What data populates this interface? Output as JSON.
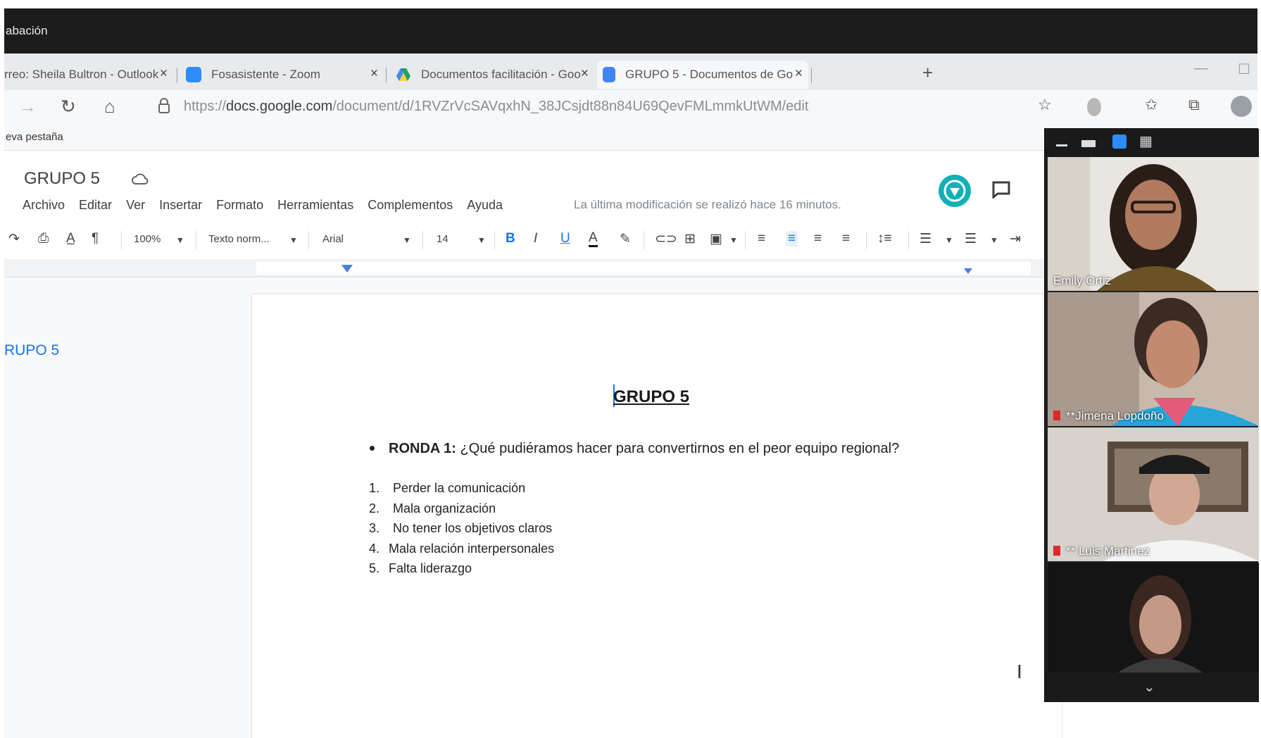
{
  "recording_bar": {
    "label": "abación"
  },
  "tabs": [
    {
      "title": "rreo: Sheila Bultron - Outlook",
      "icon": "outlook-icon"
    },
    {
      "title": "Fosasistente - Zoom",
      "icon": "zoom-icon"
    },
    {
      "title": "Documentos facilitación - Goo",
      "icon": "google-drive-icon"
    },
    {
      "title": "GRUPO 5 - Documentos de Go",
      "icon": "google-docs-icon",
      "active": true
    }
  ],
  "address_bar": {
    "prefix": "https://",
    "host": "docs.google.com",
    "path": "/document/d/1RVZrVcSAVqxhN_38JCsjdt88n84U69QevFMLmmkUtWM/edit"
  },
  "bookmarks": {
    "item": "eva pestaña"
  },
  "docs": {
    "title": "GRUPO 5",
    "menu": [
      "Archivo",
      "Editar",
      "Ver",
      "Insertar",
      "Formato",
      "Herramientas",
      "Complementos",
      "Ayuda"
    ],
    "last_edit": "La última modificación se realizó hace 16 minutos.",
    "toolbar": {
      "zoom": "100%",
      "style": "Texto norm...",
      "font": "Arial",
      "size": "14"
    },
    "outline_item": "RUPO 5"
  },
  "document": {
    "heading": "GRUPO 5",
    "bullet_label": "RONDA 1:",
    "bullet_text": "¿Qué pudiéramos hacer para convertirnos en el peor equipo regional?",
    "list": [
      {
        "num": "1.",
        "text": "Perder la comunicación"
      },
      {
        "num": "2.",
        "text": "Mala organización"
      },
      {
        "num": "3.",
        "text": "No tener los objetivos claros"
      },
      {
        "num": "4.",
        "text": "Mala relación interpersonales"
      },
      {
        "num": "5.",
        "text": "Falta liderazgo"
      }
    ]
  },
  "zoom_panel": {
    "participants": [
      {
        "name": "Emily Ortiz",
        "muted": false
      },
      {
        "name": "**Jimena Lopdoño",
        "muted": true
      },
      {
        "name": "** Luis Martinez",
        "muted": true
      },
      {
        "name": "",
        "muted": false
      }
    ]
  },
  "colors": {
    "docs_blue": "#1a73e8",
    "extension_teal": "#11b0b8",
    "recording_bar": "#1c1c1c",
    "zoom_bg": "#1f1f1f"
  }
}
